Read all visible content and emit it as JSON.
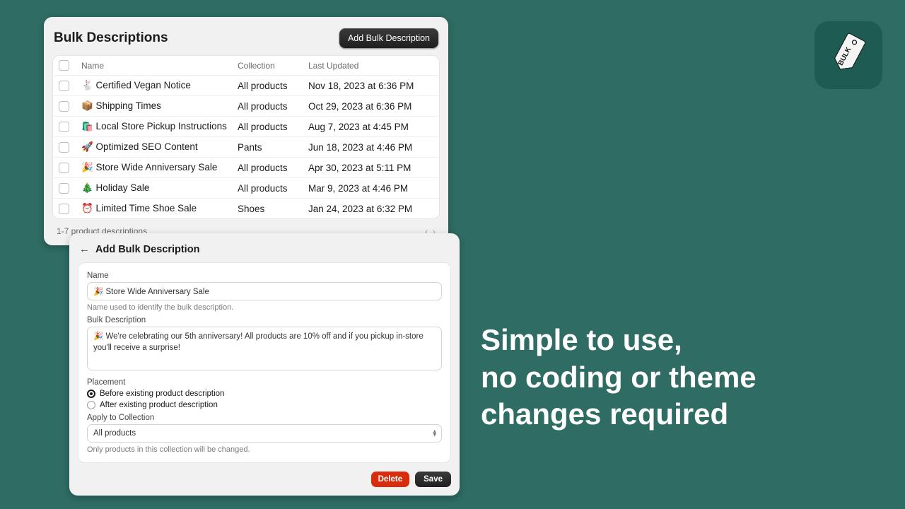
{
  "app_icon": {
    "tag_text": "BULK"
  },
  "headline_line1": "Simple to use,",
  "headline_line2": "no coding or theme",
  "headline_line3": "changes required",
  "list_panel": {
    "title": "Bulk Descriptions",
    "add_button": "Add Bulk Description",
    "columns": {
      "name": "Name",
      "collection": "Collection",
      "updated": "Last Updated"
    },
    "rows": [
      {
        "name": "🐇 Certified Vegan Notice",
        "collection": "All products",
        "updated": "Nov 18, 2023 at 6:36 PM"
      },
      {
        "name": "📦 Shipping Times",
        "collection": "All products",
        "updated": "Oct 29, 2023 at 6:36 PM"
      },
      {
        "name": "🛍️ Local Store Pickup Instructions",
        "collection": "All products",
        "updated": "Aug 7, 2023 at 4:45 PM"
      },
      {
        "name": "🚀 Optimized SEO Content",
        "collection": "Pants",
        "updated": "Jun 18, 2023 at 4:46 PM"
      },
      {
        "name": "🎉 Store Wide Anniversary Sale",
        "collection": "All products",
        "updated": "Apr 30, 2023 at 5:11 PM"
      },
      {
        "name": "🎄 Holiday Sale",
        "collection": "All products",
        "updated": "Mar 9, 2023 at 4:46 PM"
      },
      {
        "name": "⏰ Limited Time Shoe Sale",
        "collection": "Shoes",
        "updated": "Jan 24, 2023 at 6:32 PM"
      }
    ],
    "footer_count": "1-7 product descriptions"
  },
  "form_panel": {
    "title": "Add Bulk Description",
    "labels": {
      "name": "Name",
      "desc": "Bulk Description",
      "placement": "Placement",
      "apply": "Apply to Collection"
    },
    "values": {
      "name": "🎉 Store Wide Anniversary Sale",
      "desc": "🎉 We're celebrating our 5th anniversary! All products are 10% off and if you pickup in-store you'll receive a surprise!",
      "placement_before": "Before existing product description",
      "placement_after": "After existing product description",
      "collection": "All products"
    },
    "helps": {
      "name": "Name used to identify the bulk description.",
      "apply": "Only products in this collection will be changed."
    },
    "buttons": {
      "delete": "Delete",
      "save": "Save"
    }
  }
}
